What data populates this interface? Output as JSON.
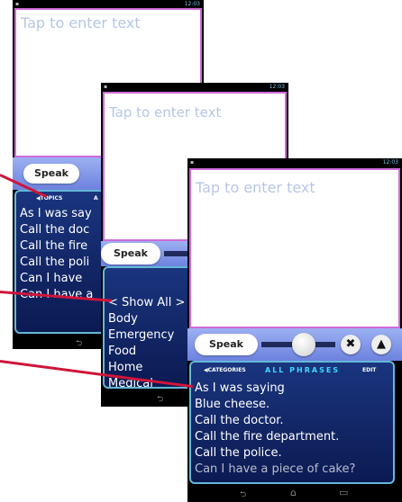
{
  "colors": {
    "accent": "#d06ad8",
    "list_bg": "#0b1a52",
    "arrow": "#d0153a",
    "placeholder": "#b7c6e4"
  },
  "status_bar": {
    "time": "12:03",
    "icons_left": "▪",
    "icons_right": "▾ ▮"
  },
  "placeholder": "Tap to enter text",
  "speak_label": "Speak",
  "screen1": {
    "tab_topics": "◀TOPICS",
    "tab_partial": "A",
    "items": [
      "As I was say",
      "Call the doc",
      "Call the fire",
      "Call the poli",
      "Can I have",
      "Can I have a"
    ]
  },
  "screen2": {
    "items": [
      "< Show All >",
      "Body",
      "Emergency",
      "Food",
      "Home",
      "Medical"
    ]
  },
  "screen3": {
    "tab_categories": "◀CATEGORIES",
    "tab_all_phrases": "ALL PHRASES",
    "tab_edit": "EDIT",
    "close_icon": "✖",
    "up_icon": "▲",
    "items": [
      "As I was saying",
      "Blue cheese.",
      "Call the doctor.",
      "Call the fire department.",
      "Call the police.",
      "Can I have a piece of cake?"
    ]
  },
  "nav": {
    "back": "⮌",
    "home": "⌂",
    "recent": "▭"
  }
}
